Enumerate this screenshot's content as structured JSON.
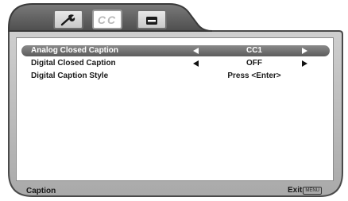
{
  "tabs": [
    {
      "name": "settings",
      "icon": "wrench-icon"
    },
    {
      "name": "closed-caption",
      "label": "CC",
      "active": true
    },
    {
      "name": "lock",
      "icon": "lock-icon"
    }
  ],
  "menu": {
    "rows": [
      {
        "label": "Analog Closed Caption",
        "value": "CC1",
        "selected": true,
        "has_arrows": true
      },
      {
        "label": "Digital Closed Caption",
        "value": "OFF",
        "selected": false,
        "has_arrows": true
      },
      {
        "label": "Digital Caption Style",
        "value": "Press <Enter>",
        "selected": false,
        "has_arrows": false
      }
    ]
  },
  "footer": {
    "title": "Caption",
    "exit_label": "Exit",
    "exit_key": "MENU"
  },
  "colors": {
    "frame": "#b5b5b5",
    "frame_dark": "#5a5a5a",
    "highlight": "#6f6f6f",
    "text": "#1a1a1a"
  }
}
